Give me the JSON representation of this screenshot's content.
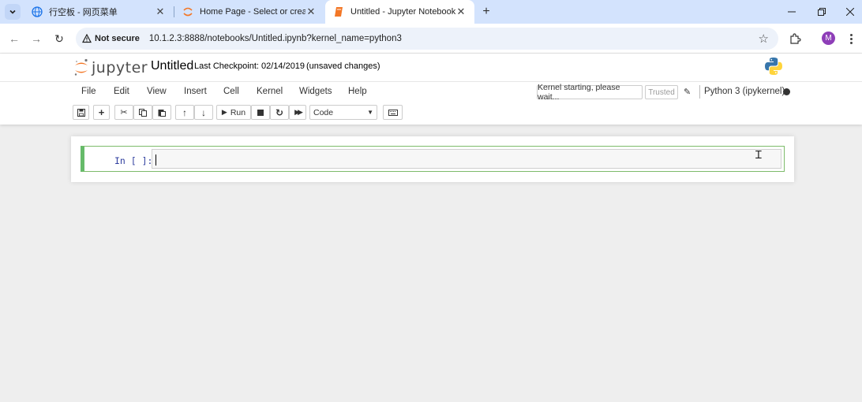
{
  "browser": {
    "tabs": [
      {
        "title": "行空板 - 网页菜单",
        "icon": "globe-icon"
      },
      {
        "title": "Home Page - Select or create a",
        "icon": "jupyter-icon"
      },
      {
        "title": "Untitled - Jupyter Notebook",
        "icon": "notebook-icon",
        "active": true
      }
    ],
    "security_label": "Not secure",
    "url": "10.1.2.3:8888/notebooks/Untitled.ipynb?kernel_name=python3",
    "profile_initial": "M"
  },
  "jupyter": {
    "logo_text": "jupyter",
    "notebook_title": "Untitled",
    "checkpoint": "Last Checkpoint: 02/14/2019",
    "unsaved": "(unsaved changes)",
    "menu": [
      "File",
      "Edit",
      "View",
      "Insert",
      "Cell",
      "Kernel",
      "Widgets",
      "Help"
    ],
    "kernel_status": "Kernel starting, please wait...",
    "trusted_label": "Trusted",
    "kernel_name": "Python 3 (ipykernel)",
    "toolbar": {
      "run_label": "Run",
      "cell_type": "Code"
    },
    "cell": {
      "prompt": "In [ ]:"
    }
  },
  "colors": {
    "tabstrip": "#d3e3fd",
    "cell_border": "#66bb6a",
    "prompt": "#303f9f",
    "jupyter_orange": "#f37726"
  }
}
